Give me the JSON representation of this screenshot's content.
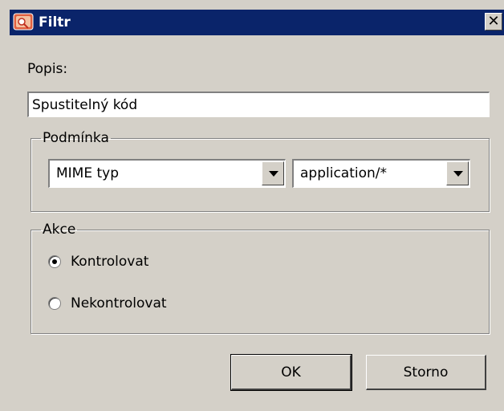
{
  "window": {
    "title": "Filtr",
    "close_glyph": "✕"
  },
  "description": {
    "label": "Popis:",
    "value": "Spustitelný kód"
  },
  "condition": {
    "legend": "Podmínka",
    "field_select": "MIME typ",
    "value_select": "application/*"
  },
  "action": {
    "legend": "Akce",
    "options": [
      {
        "label": "Kontrolovat",
        "checked": true
      },
      {
        "label": "Nekontrolovat",
        "checked": false
      }
    ]
  },
  "buttons": {
    "ok": "OK",
    "cancel": "Storno"
  },
  "colors": {
    "titlebar": "#0a246a",
    "dialog_bg": "#d4d0c8"
  }
}
